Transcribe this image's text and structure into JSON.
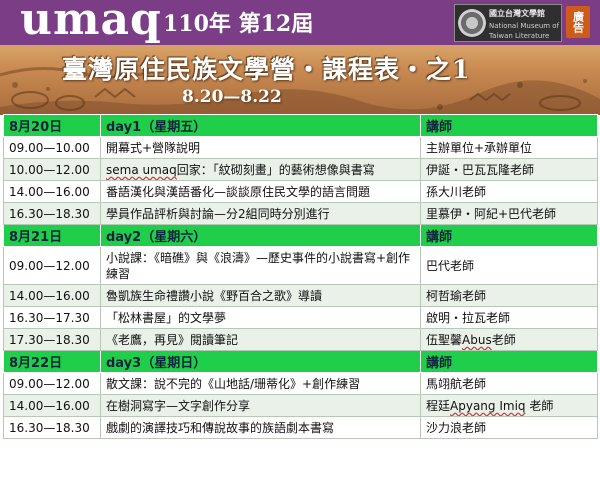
{
  "header": {
    "brand": "umaq",
    "edition": "110年 第12屆",
    "camp_title": "臺灣原住民族文學營・課程表・之1",
    "dates": "8.20—8.22",
    "logo": {
      "line1": "國立台灣文學館",
      "line2": "National Museum of",
      "line3": "Taiwan Literature"
    },
    "ad_badge": "廣告",
    "colors": {
      "purple": "#7a3d86",
      "banner": "#c98a52",
      "day_row": "#1fcf4a",
      "alt_row": "#e9f1e9"
    }
  },
  "days": [
    {
      "date": "8月20日",
      "day_label": "day1（星期五）",
      "lecturer_header": "講師",
      "sessions": [
        {
          "time": "09.00—10.00",
          "title": "開幕式+營隊說明",
          "lecturer": "主辦單位+承辦單位"
        },
        {
          "time": "10.00—12.00",
          "title_highlight": "sema umaq",
          "title": "回家：「紋砌刻畫」的藝術想像與書寫",
          "lecturer": "伊誕・巴瓦瓦隆老師"
        },
        {
          "time": "14.00—16.00",
          "title": "番語漢化與漢語番化—談談原住民文學的語言問題",
          "lecturer": "孫大川老師"
        },
        {
          "time": "16.30—18.30",
          "title": "學員作品評析與討論—分2組同時分別進行",
          "lecturer": "里慕伊・阿紀+巴代老師"
        }
      ]
    },
    {
      "date": "8月21日",
      "day_label": "day2（星期六）",
      "lecturer_header": "講師",
      "sessions": [
        {
          "time": "09.00—12.00",
          "title": "小說課：《暗礁》與《浪濤》—歷史事件的小說書寫+創作練習",
          "lecturer": "巴代老師"
        },
        {
          "time": "14.00—16.00",
          "title": "魯凱族生命禮讚小說《野百合之歌》導讀",
          "lecturer": "柯哲瑜老師"
        },
        {
          "time": "16.30—17.30",
          "title": "「松林書屋」的文學夢",
          "lecturer": "啟明・拉瓦老師"
        },
        {
          "time": "17.30—18.30",
          "title": "《老鷹，再見》閱讀筆記",
          "lecturer_prefix": "伍聖馨",
          "lecturer_highlight": "Abus",
          "lecturer": "老師"
        }
      ]
    },
    {
      "date": "8月22日",
      "day_label": "day3（星期日）",
      "lecturer_header": "講師",
      "sessions": [
        {
          "time": "09.00—12.00",
          "title": "散文課：說不完的《山地話/珊蒂化》+創作練習",
          "lecturer": "馬翊航老師"
        },
        {
          "time": "14.00—16.00",
          "title": "在樹洞寫字—文字創作分享",
          "lecturer_prefix": "程廷",
          "lecturer_highlight": "Apyang Imiq",
          "lecturer": " 老師"
        },
        {
          "time": "16.30—18.30",
          "title": "戲劇的演譯技巧和傳說故事的族語劇本書寫",
          "lecturer": "沙力浪老師"
        }
      ]
    }
  ]
}
